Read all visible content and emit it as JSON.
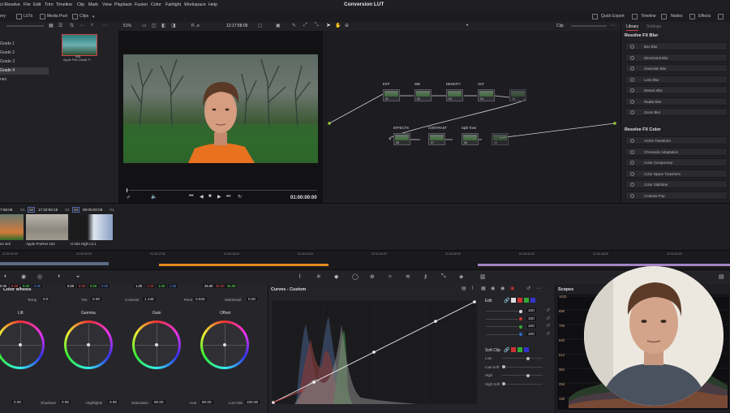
{
  "menubar": {
    "items": [
      "ci Resolve",
      "File",
      "Edit",
      "Trim",
      "Timeline",
      "Clip",
      "Mark",
      "View",
      "Playback",
      "Fusion",
      "Color",
      "Fairlight",
      "Workspace",
      "Help"
    ],
    "title": "Conversion LUT"
  },
  "toolbar": {
    "left": [
      "ery",
      "LUTs",
      "Media Pool",
      "Clips"
    ],
    "right": [
      "Quick Export",
      "Timeline",
      "Nodes",
      "Effects"
    ]
  },
  "toolbar2": {
    "zoom": "51%",
    "clip_name": "P...o",
    "timecode": "12:17:58:09",
    "clip_mode": "Clip"
  },
  "leftpanel": {
    "grades": [
      "Grade 1",
      "Grade 2",
      "Grade 3",
      "Grade 4",
      "nes"
    ],
    "active_index": 3,
    "thumb_label": "Apple Film Grade P...",
    "thumb_num": "008"
  },
  "viewer": {
    "timecode": "01:00:00:00"
  },
  "nodes": {
    "list": [
      {
        "label": "EXP",
        "num": "01"
      },
      {
        "label": "WB",
        "num": "02"
      },
      {
        "label": "DENSITY",
        "num": "03"
      },
      {
        "label": "SAT",
        "num": "04"
      },
      {
        "label": "",
        "num": "05"
      },
      {
        "label": "EFFECTS",
        "num": "06"
      },
      {
        "label": "CONTRAST",
        "num": "07"
      },
      {
        "label": "Split Tone",
        "num": "08"
      },
      {
        "label": "",
        "num": "09"
      }
    ]
  },
  "library": {
    "tabs": [
      "Library",
      "Settings"
    ],
    "blur_head": "Resolve FX Blur",
    "blur_items": [
      "Box Blur",
      "Directional Blur",
      "Gaussian Blur",
      "Lens Blur",
      "Mosaic Blur",
      "Radial Blur",
      "Zoom Blur"
    ],
    "color_head": "Resolve FX Color",
    "color_items": [
      "ACES Transform",
      "Chromatic Adaptation",
      "Color Compressor",
      "Color Space Transform",
      "Color Stabilizer",
      "Contrast Pop"
    ]
  },
  "clipstrip": {
    "tc1": "7:58:09",
    "tc1_track": "V1",
    "tc1_num": "02",
    "tc2": "17:32:50:18",
    "tc2_track": "V1",
    "tc2_num": "03",
    "tc3": "00:00:00:09",
    "tc3_track": "V1",
    "clips": [
      "es 422",
      "Apple ProRes 422",
      "H.264 High L5.1"
    ]
  },
  "timeline": {
    "ticks": [
      "01:00:00:00",
      "01:00:06:00",
      "01:00:12:00",
      "01:00:18:00",
      "01:00:24:00",
      "01:00:30:00",
      "01:00:36:00",
      "01:00:42:00",
      "01:00:48:00",
      "01:00:54:00"
    ]
  },
  "colorwheels": {
    "title": "Color Wheels",
    "temp_label": "Temp",
    "temp_val": "0.0",
    "tint_label": "Tint",
    "tint_val": "0.00",
    "contrast_label": "Contrast",
    "contrast_val": "1.136",
    "pivot_label": "Pivot",
    "pivot_val": "0.625",
    "middetail_label": "Mid/Detail",
    "middetail_val": "0.00",
    "wheels": [
      {
        "name": "Lift",
        "vals": [
          "0.00",
          "0.00",
          "0.00",
          "0.00"
        ]
      },
      {
        "name": "Gamma",
        "vals": [
          "0.00",
          "0.00",
          "0.00",
          "0.00"
        ]
      },
      {
        "name": "Gain",
        "vals": [
          "1.00",
          "1.00",
          "1.00",
          "1.00"
        ]
      },
      {
        "name": "Offset",
        "vals": [
          "25.00",
          "25.00",
          "25.00",
          ""
        ]
      }
    ],
    "shadows_label": "Shadows",
    "shadows_val": "0.00",
    "highlights_label": "Highlights",
    "highlights_val": "0.00",
    "saturation_label": "Saturation",
    "saturation_val": "50.00",
    "hue_label": "Hue",
    "hue_val": "50.00",
    "lummix_label": "Lum Mix",
    "lummix_val": "100.00",
    "bottom_left_val": "0.00"
  },
  "curves": {
    "title": "Curves - Custom",
    "edit_label": "Edit",
    "channel_vals": [
      "100",
      "100",
      "100",
      "100"
    ],
    "softclip_label": "Soft Clip",
    "softclip_items": [
      "Low",
      "Low Soft",
      "High",
      "High Soft"
    ]
  },
  "scopes": {
    "title": "Scopes",
    "axis": [
      "1023",
      "896",
      "768",
      "640",
      "512",
      "384",
      "256",
      "128"
    ]
  }
}
